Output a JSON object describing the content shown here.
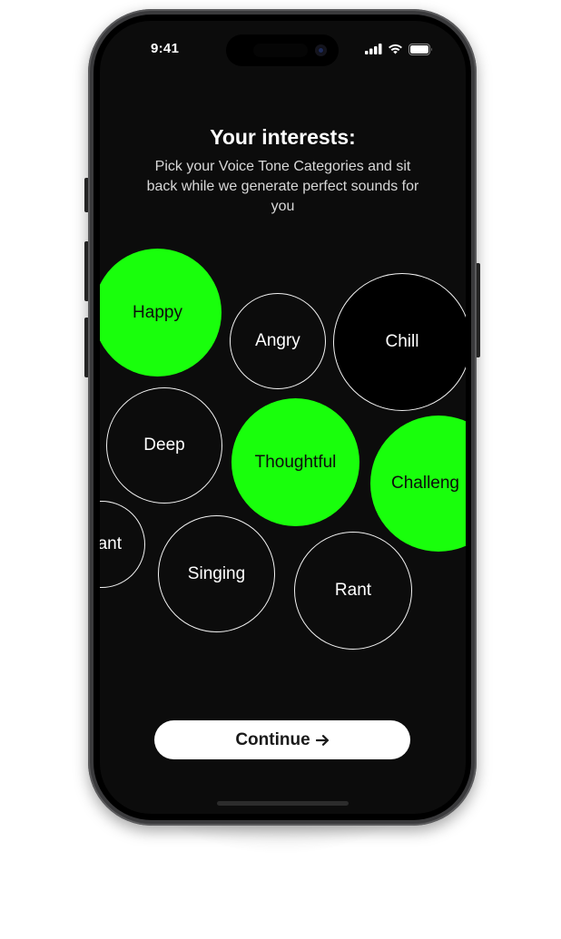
{
  "status_bar": {
    "time": "9:41"
  },
  "onboarding": {
    "title": "Your interests:",
    "subtitle": "Pick your Voice Tone Categories and sit back while we generate perfect sounds for you",
    "categories": [
      {
        "label": "Happy",
        "selected": true
      },
      {
        "label": "Angry",
        "selected": false
      },
      {
        "label": "Chill",
        "selected": false
      },
      {
        "label": "Deep",
        "selected": false
      },
      {
        "label": "Thoughtful",
        "selected": true
      },
      {
        "label": "Challeng",
        "selected": true
      },
      {
        "label": "ant",
        "selected": false
      },
      {
        "label": "Singing",
        "selected": false
      },
      {
        "label": "Rant",
        "selected": false
      }
    ],
    "continue_label": "Continue",
    "continue_icon": "arrow-right-icon"
  },
  "colors": {
    "accent_green": "#19ff0c",
    "background": "#0c0c0c",
    "button": "#ffffff"
  }
}
